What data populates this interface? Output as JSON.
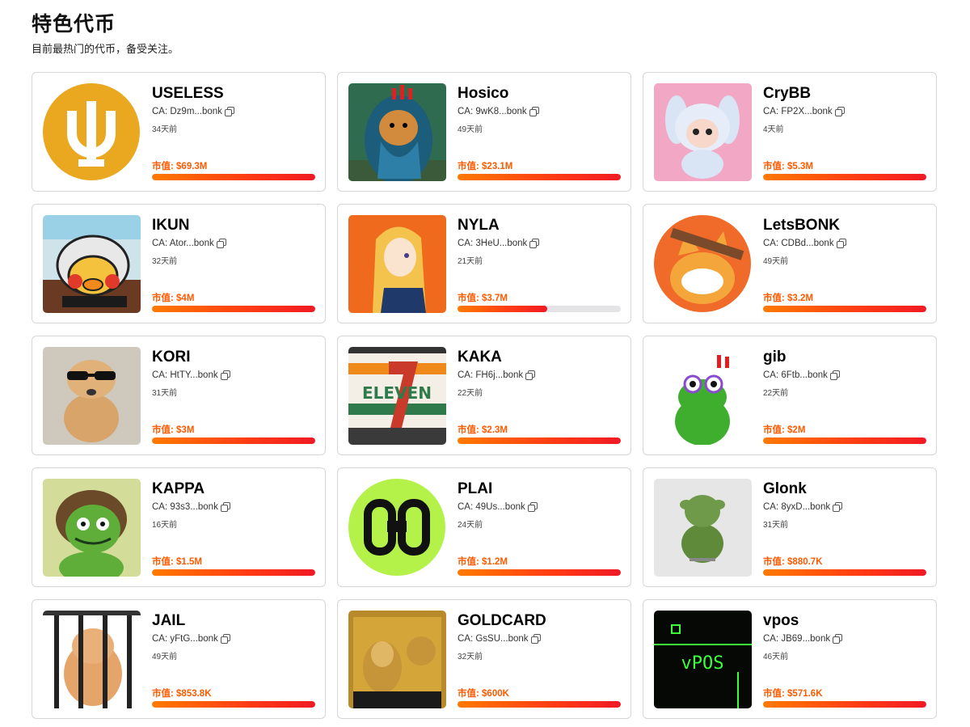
{
  "header": {
    "title": "特色代币",
    "subtitle": "目前最热门的代币，备受关注。"
  },
  "mcap_prefix": "市值: ",
  "accent_color": "#ff5a00",
  "tokens": [
    {
      "name": "USELESS",
      "ca": "CA: Dz9m...bonk",
      "age": "34天前",
      "mcap": "$69.3M",
      "progress": 1.0,
      "image_icon": "useless-logo-icon"
    },
    {
      "name": "Hosico",
      "ca": "CA: 9wK8...bonk",
      "age": "49天前",
      "mcap": "$23.1M",
      "progress": 1.0,
      "image_icon": "hosico-cat-icon"
    },
    {
      "name": "CryBB",
      "ca": "CA: FP2X...bonk",
      "age": "4天前",
      "mcap": "$5.3M",
      "progress": 1.0,
      "image_icon": "crybb-doll-icon"
    },
    {
      "name": "IKUN",
      "ca": "CA: Ator...bonk",
      "age": "32天前",
      "mcap": "$4M",
      "progress": 1.0,
      "image_icon": "ikun-chicken-icon"
    },
    {
      "name": "NYLA",
      "ca": "CA: 3HeU...bonk",
      "age": "21天前",
      "mcap": "$3.7M",
      "progress": 0.55,
      "image_icon": "nyla-anime-icon"
    },
    {
      "name": "LetsBONK",
      "ca": "CA: CDBd...bonk",
      "age": "49天前",
      "mcap": "$3.2M",
      "progress": 1.0,
      "image_icon": "letsbonk-dog-icon"
    },
    {
      "name": "KORI",
      "ca": "CA: HtTY...bonk",
      "age": "31天前",
      "mcap": "$3M",
      "progress": 1.0,
      "image_icon": "kori-dog-icon"
    },
    {
      "name": "KAKA",
      "ca": "CA: FH6j...bonk",
      "age": "22天前",
      "mcap": "$2.3M",
      "progress": 1.0,
      "image_icon": "kaka-eleven-icon"
    },
    {
      "name": "gib",
      "ca": "CA: 6Ftb...bonk",
      "age": "22天前",
      "mcap": "$2M",
      "progress": 1.0,
      "image_icon": "gib-frog-icon"
    },
    {
      "name": "KAPPA",
      "ca": "CA: 93s3...bonk",
      "age": "16天前",
      "mcap": "$1.5M",
      "progress": 1.0,
      "image_icon": "kappa-frog-icon"
    },
    {
      "name": "PLAI",
      "ca": "CA: 49Us...bonk",
      "age": "24天前",
      "mcap": "$1.2M",
      "progress": 1.0,
      "image_icon": "plai-logo-icon"
    },
    {
      "name": "Glonk",
      "ca": "CA: 8yxD...bonk",
      "age": "31天前",
      "mcap": "$880.7K",
      "progress": 1.0,
      "image_icon": "glonk-figure-icon"
    },
    {
      "name": "JAIL",
      "ca": "CA: yFtG...bonk",
      "age": "49天前",
      "mcap": "$853.8K",
      "progress": 1.0,
      "image_icon": "jail-dog-icon"
    },
    {
      "name": "GOLDCARD",
      "ca": "CA: GsSU...bonk",
      "age": "32天前",
      "mcap": "$600K",
      "progress": 1.0,
      "image_icon": "goldcard-icon"
    },
    {
      "name": "vpos",
      "ca": "CA: JB69...bonk",
      "age": "46天前",
      "mcap": "$571.6K",
      "progress": 1.0,
      "image_icon": "vpos-terminal-icon"
    }
  ]
}
